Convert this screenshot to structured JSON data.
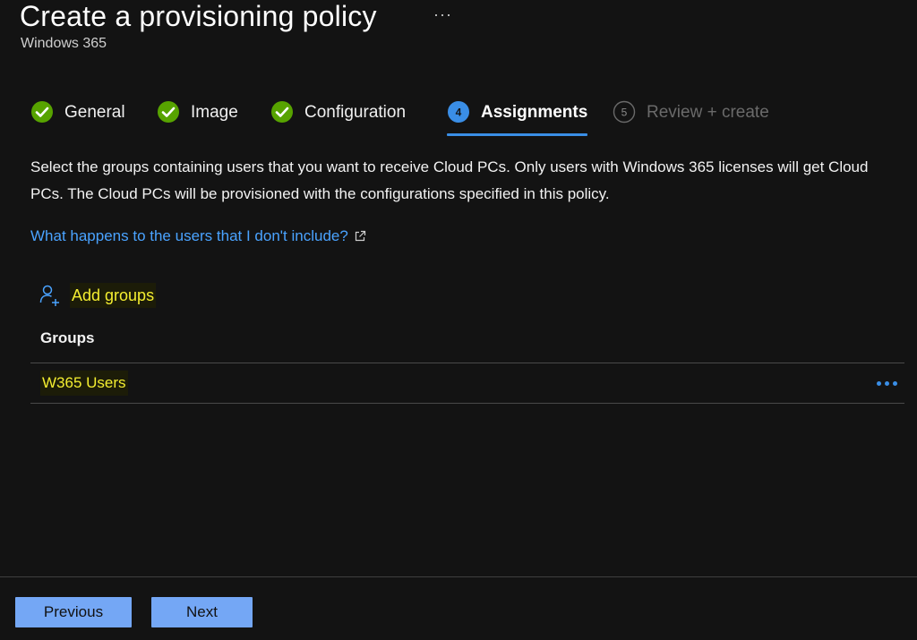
{
  "header": {
    "title": "Create a provisioning policy",
    "more_label": "···",
    "subtitle": "Windows 365"
  },
  "steps": [
    {
      "label": "General",
      "state": "completed"
    },
    {
      "label": "Image",
      "state": "completed"
    },
    {
      "label": "Configuration",
      "state": "completed"
    },
    {
      "label": "Assignments",
      "state": "active",
      "number": "4"
    },
    {
      "label": "Review + create",
      "state": "disabled",
      "number": "5"
    }
  ],
  "content": {
    "description": "Select the groups containing users that you want to receive Cloud PCs. Only users with Windows 365 licenses will get Cloud PCs. The Cloud PCs will be provisioned with the configurations specified in this policy.",
    "learn_link": "What happens to the users that I don't include?",
    "add_groups_label": "Add groups",
    "groups_header": "Groups",
    "groups": [
      {
        "name": "W365 Users"
      }
    ]
  },
  "footer": {
    "previous_label": "Previous",
    "next_label": "Next"
  },
  "colors": {
    "background": "#131313",
    "accent": "#3a8ee6",
    "success": "#57a300",
    "link": "#4aa3ff",
    "highlight": "#f4ee30",
    "button": "#74a7f5"
  },
  "icons": {
    "completed": "checkmark-circle-icon",
    "external": "external-link-icon",
    "add_group": "add-person-icon",
    "more": "more-options-icon"
  }
}
